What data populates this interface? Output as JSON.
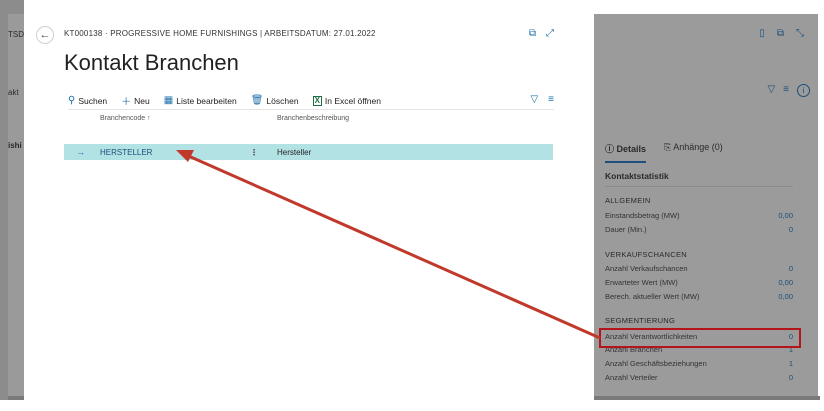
{
  "background": {
    "left_texts": [
      "TSD",
      "akt",
      "ishi"
    ]
  },
  "dialog": {
    "breadcrumb": "KT000138 · PROGRESSIVE HOME FURNISHINGS | ARBEITSDATUM: 27.01.2022",
    "title": "Kontakt Branchen",
    "actions": {
      "search": "Suchen",
      "new": "Neu",
      "edit_list": "Liste bearbeiten",
      "delete": "Löschen",
      "open_excel": "In Excel öffnen"
    },
    "columns": {
      "code": "Branchencode ↑",
      "description": "Branchenbeschreibung"
    },
    "rows": [
      {
        "code": "HERSTELLER",
        "description": "Hersteller"
      }
    ]
  },
  "factbox": {
    "tabs": {
      "details": "Details",
      "attachments": "Anhänge (0)"
    },
    "section_title": "Kontaktstatistik",
    "groups": [
      {
        "title": "ALLGEMEIN",
        "fields": [
          {
            "label": "Einstandsbetrag (MW)",
            "value": "0,00"
          },
          {
            "label": "Dauer (Min.)",
            "value": "0"
          }
        ]
      },
      {
        "title": "VERKAUFSCHANCEN",
        "fields": [
          {
            "label": "Anzahl Verkaufschancen",
            "value": "0"
          },
          {
            "label": "Erwarteter Wert (MW)",
            "value": "0,00"
          },
          {
            "label": "Berech. aktueller Wert (MW)",
            "value": "0,00"
          }
        ]
      },
      {
        "title": "SEGMENTIERUNG",
        "fields": [
          {
            "label": "Anzahl Verantwortlichkeiten",
            "value": "0"
          },
          {
            "label": "Anzahl Branchen",
            "value": "1"
          },
          {
            "label": "Anzahl Geschäftsbeziehungen",
            "value": "1"
          },
          {
            "label": "Anzahl Verteiler",
            "value": "0"
          }
        ]
      }
    ]
  },
  "colors": {
    "accent": "#1e6fa8",
    "selected_row": "#b3e2e5",
    "annotation_red": "#b3151a"
  }
}
